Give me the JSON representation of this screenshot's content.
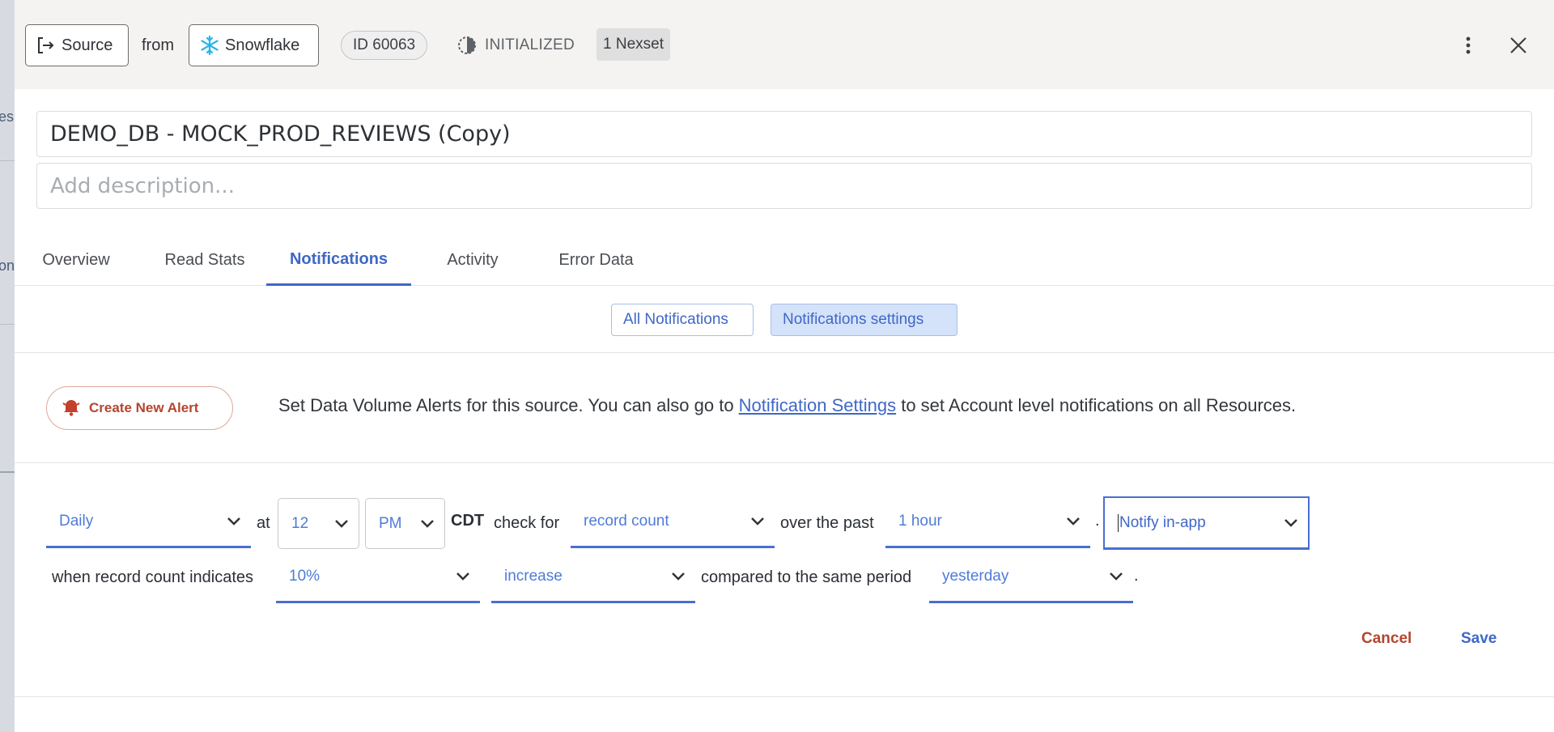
{
  "background": {
    "fragment_top": "es",
    "fragment_mid": "on"
  },
  "header": {
    "source_label": "Source",
    "from_label": "from",
    "connector_label": "Snowflake",
    "id_label": "ID 60063",
    "status_label": "INITIALIZED",
    "nexset_label": "1 Nexset",
    "icons": [
      "source-arrow-icon",
      "snowflake-icon",
      "status-half-circle-icon",
      "more-vertical-icon",
      "close-icon"
    ]
  },
  "resource": {
    "title": "DEMO_DB - MOCK_PROD_REVIEWS (Copy)",
    "description_placeholder": "Add description..."
  },
  "tabs": [
    {
      "label": "Overview"
    },
    {
      "label": "Read Stats"
    },
    {
      "label": "Notifications",
      "active": true
    },
    {
      "label": "Activity"
    },
    {
      "label": "Error Data"
    }
  ],
  "subtabs": [
    {
      "label": "All Notifications"
    },
    {
      "label": "Notifications settings",
      "active": true
    }
  ],
  "alert_intro": {
    "create_label": "Create New Alert",
    "text_before": "Set Data Volume Alerts for this source. You can also go to ",
    "link_label": "Notification Settings",
    "text_after": " to set Account level notifications on all Resources."
  },
  "alert_rule": {
    "frequency": "Daily",
    "at_label": "at",
    "hour": "12",
    "meridiem": "PM",
    "timezone": "CDT",
    "check_for_label": "check for",
    "metric": "record count",
    "over_past_label": "over the past",
    "window": "1 hour",
    "period_dot": ".",
    "notify": "Notify in-app",
    "when_label": "when record count indicates",
    "threshold": "10%",
    "direction": "increase",
    "compared_label": "compared to the same period",
    "comparison": "yesterday",
    "end_dot": "."
  },
  "actions": {
    "cancel_label": "Cancel",
    "save_label": "Save"
  },
  "colors": {
    "accent": "#3f67c7",
    "danger": "#b5452e",
    "header_bg": "#f4f3f1",
    "active_subtab_bg": "#d4e3fa"
  }
}
